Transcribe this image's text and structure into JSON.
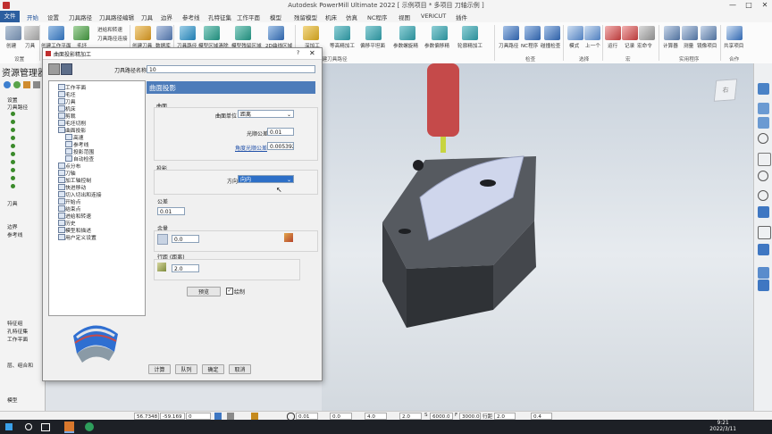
{
  "window": {
    "title": "Autodesk PowerMill Ultimate 2022  [ 示例项目 * 多项目 刀轴示例 ]",
    "buttons": [
      "—",
      "□",
      "✕"
    ]
  },
  "ribbon": {
    "tabs": [
      "文件",
      "开始",
      "设置",
      "刀具路径",
      "刀具路径编辑",
      "刀具",
      "边界",
      "参考线",
      "孔特征集",
      "工作平面",
      "模型",
      "残留模型",
      "机床",
      "仿真",
      "NC程序",
      "视图",
      "VERICUT",
      "插件"
    ],
    "active_tab": "开始",
    "groups": [
      {
        "label": "设置",
        "items": [
          "创建",
          "刀具",
          "切削参数"
        ]
      },
      {
        "label": "",
        "items": [
          "创建工作平面",
          "毛坯",
          "进给和转速",
          "刀具路径连接"
        ]
      },
      {
        "label": "",
        "items": [
          "创建刀具",
          "数据库"
        ]
      },
      {
        "label": "",
        "items": [
          "刀具路径",
          "模型区域清除",
          "模型残留区域",
          "2D曲线区域"
        ]
      },
      {
        "label": "创建刀具路径",
        "items": [
          "深加工",
          "等高精加工",
          "偏移平坦面",
          "参数螺旋精",
          "参数偏移精",
          "轮廓精加工"
        ]
      },
      {
        "label": "检查",
        "items": [
          "刀具路径",
          "NC程序",
          "碰撞检查"
        ]
      },
      {
        "label": "选择",
        "items": [
          "模式",
          "上一个"
        ]
      },
      {
        "label": "宏",
        "items": [
          "运行",
          "记录",
          "宏命令"
        ]
      },
      {
        "label": "实用程序",
        "items": [
          "计算器",
          "测量",
          "镜像项目"
        ]
      },
      {
        "label": "合作",
        "items": [
          "共享项目"
        ]
      }
    ]
  },
  "explorer": {
    "title": "资源管理器",
    "items": [
      "设置",
      "刀具路径",
      "刀具",
      "边界",
      "参考线",
      "特征组",
      "孔特征集",
      "工作平面",
      "层、组合和",
      "模型"
    ]
  },
  "dialog": {
    "title": "曲面投影精加工",
    "path_name_label": "刀具路径名称",
    "path_name_value": "10",
    "panel_header": "曲面投影",
    "tree": [
      "工作平面",
      "毛坯",
      "刀具",
      "机床",
      "剪裁",
      "毛坯切削",
      "曲面投影",
      "高速",
      "参考线",
      "投影范围",
      "自动检查",
      "点分布",
      "刀轴",
      "加工轴控制",
      "快进移动",
      "切入切出和连接",
      "开始点",
      "结束点",
      "进给和转速",
      "历史",
      "模型和描述",
      "用户定义设置"
    ],
    "surface": {
      "section": "曲面",
      "unit_label": "曲面单位",
      "unit_value": "距离",
      "tol_label": "光顺公差",
      "tol_value": "0.01",
      "angle_tol_label": "角度光顺公差",
      "angle_tol_value": "0.005392"
    },
    "projection": {
      "section": "投影",
      "dir_label": "方向",
      "dir_value": "向内"
    },
    "tolerance": {
      "label": "公差",
      "value": "0.01"
    },
    "allowance": {
      "label": "余量",
      "value": "0.0"
    },
    "stepover": {
      "label": "行距 (距离)",
      "value": "2.0"
    },
    "preview_label": "预览",
    "draw_label": "绘制",
    "buttons": [
      "计算",
      "队列",
      "确定",
      "取消"
    ]
  },
  "status": {
    "coords": [
      "56.7348",
      "-59.169",
      "0"
    ],
    "tol": "0.01",
    "stock": "0.0",
    "tool_dia": "4.0",
    "stepdown": "2.0",
    "speed": "6000.0",
    "feed": "3000.0",
    "stepover_label": "行距",
    "stepover": "2.0",
    "pitch": "0.4"
  },
  "taskbar": {
    "time": "9:21",
    "date": "2022/3/11"
  },
  "colors": {
    "accent": "#2c5e9f",
    "header": "#4d7cba",
    "green": "#3a8a2a",
    "tool_red": "#c54a4a"
  }
}
